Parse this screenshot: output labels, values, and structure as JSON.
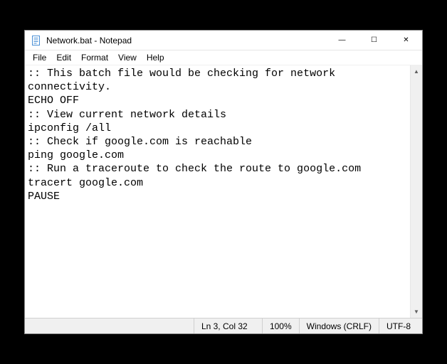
{
  "titlebar": {
    "title": "Network.bat - Notepad"
  },
  "window_controls": {
    "minimize_glyph": "—",
    "maximize_glyph": "☐",
    "close_glyph": "✕"
  },
  "menubar": {
    "items": [
      "File",
      "Edit",
      "Format",
      "View",
      "Help"
    ]
  },
  "editor": {
    "content": ":: This batch file would be checking for network connectivity.\nECHO OFF\n:: View current network details\nipconfig /all\n:: Check if google.com is reachable\nping google.com\n:: Run a traceroute to check the route to google.com\ntracert google.com\nPAUSE"
  },
  "statusbar": {
    "position": "Ln 3, Col 32",
    "zoom": "100%",
    "line_ending": "Windows (CRLF)",
    "encoding": "UTF-8"
  },
  "scroll": {
    "up_glyph": "▲",
    "down_glyph": "▼"
  }
}
